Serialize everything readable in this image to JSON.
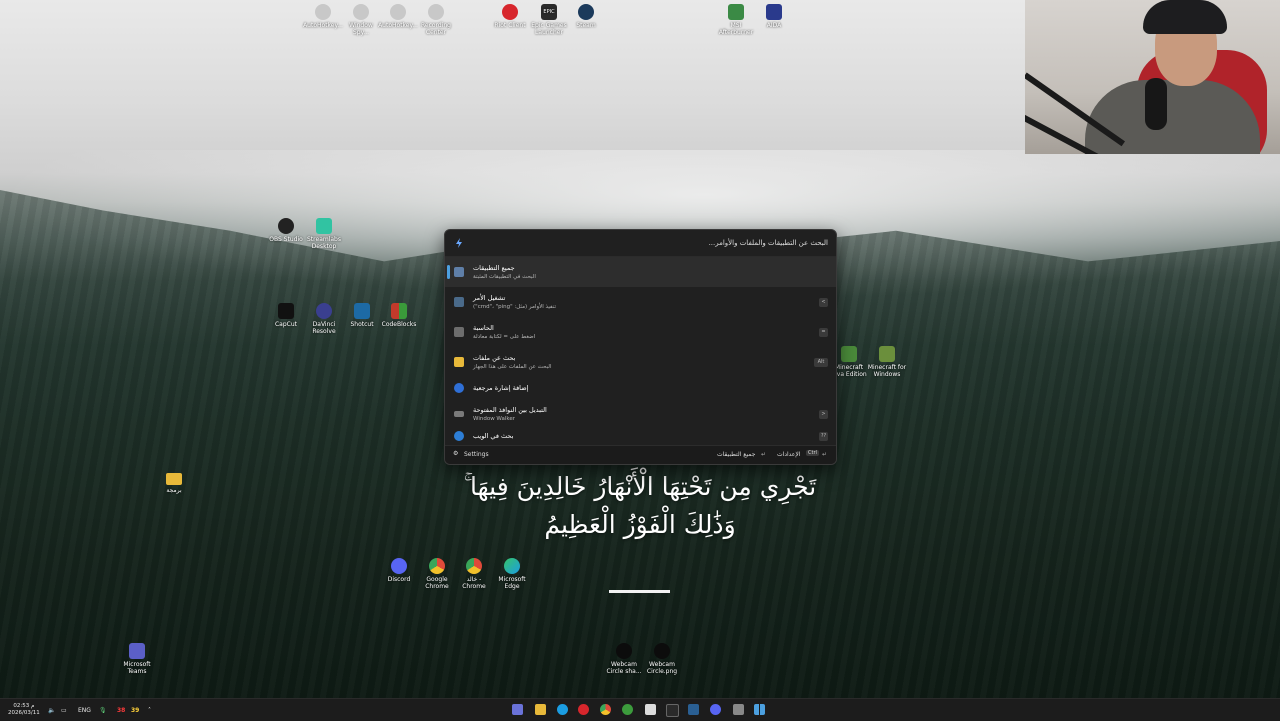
{
  "desktop": {
    "top_icons": [
      {
        "label": "AutoHotkey...",
        "color": "#c8c8c8"
      },
      {
        "label": "Window Spy...",
        "color": "#c8c8c8"
      },
      {
        "label": "AutoHotkey...",
        "color": "#c8c8c8"
      },
      {
        "label": "Recording Center",
        "color": "#c8c8c8"
      },
      {
        "label": "Riot Client",
        "color": "#d7262c"
      },
      {
        "label": "Epic Games Launcher",
        "color": "#2a2a2a"
      },
      {
        "label": "Steam",
        "color": "#1b3a5b"
      },
      {
        "label": "MSI Afterburner",
        "color": "#3b8a45"
      },
      {
        "label": "AIDA",
        "color": "#2a3a8c"
      }
    ],
    "icons": [
      {
        "label": "OBS Studio",
        "color": "#222222"
      },
      {
        "label": "Streamlabs Desktop",
        "color": "#31c3a2"
      },
      {
        "label": "CapCut",
        "color": "#111111"
      },
      {
        "label": "DaVinci Resolve",
        "color": "#3a3f8f"
      },
      {
        "label": "Shotcut",
        "color": "#1d6aa5"
      },
      {
        "label": "CodeBlocks",
        "color": "#c23a2b"
      },
      {
        "label": "Minecraft Java Edition",
        "color": "#4a8a3a"
      },
      {
        "label": "Minecraft for Windows",
        "color": "#6b8f3c"
      },
      {
        "label": "برمجة",
        "color": "#e8b93a"
      },
      {
        "label": "Discord",
        "color": "#5865f2"
      },
      {
        "label": "Google Chrome",
        "color": "#e04a3a"
      },
      {
        "label": "خالد - Chrome",
        "color": "#e04a3a"
      },
      {
        "label": "Microsoft Edge",
        "color": "#1b9de2"
      },
      {
        "label": "Microsoft Teams",
        "color": "#5b5fc7"
      },
      {
        "label": "Webcam Circle sha...",
        "color": "#0c0c0c"
      },
      {
        "label": "Webcam Circle.png",
        "color": "#0c0c0c"
      }
    ],
    "verse_line1": "تَجْرِي مِن تَحْتِهَا الْأَنْهَارُ خَالِدِينَ فِيهَا ۚ",
    "verse_line2": "وَذَٰلِكَ الْفَوْزُ الْعَظِيمُ"
  },
  "launcher": {
    "placeholder": "البحث عن التطبيقات والملفات والأوامر...",
    "accent": "#4ca0e0",
    "results": [
      {
        "title": "جميع التطبيقات",
        "subtitle": "البحث في التطبيقات المثبتة",
        "icon": "grid-icon",
        "color": "#5f7fa8",
        "hint": ""
      },
      {
        "title": "تشغيل الأمر",
        "subtitle": "تنفيذ الأوامر (مثل: \"cmd\"، \"ping\")",
        "icon": "terminal-icon",
        "color": "#4a6a8a",
        "hint": ">"
      },
      {
        "title": "الحاسبة",
        "subtitle": "اضغط على = لكتابة معادلة",
        "icon": "calculator-icon",
        "color": "#6d6d6d",
        "hint": "="
      },
      {
        "title": "بحث عن ملفات",
        "subtitle": "البحث عن الملفات على هذا الجهاز",
        "icon": "folder-icon",
        "color": "#e8b93a",
        "hint": "Alt"
      },
      {
        "title": "إضافة إشارة مرجعية",
        "subtitle": "",
        "icon": "bookmark-icon",
        "color": "#2f6fd6",
        "hint": ""
      },
      {
        "title": "التبديل بين النوافذ المفتوحة",
        "subtitle": "Window Walker",
        "icon": "window-icon",
        "color": "#7a7a7a",
        "hint": "<"
      },
      {
        "title": "بحث في الويب",
        "subtitle": "",
        "icon": "globe-icon",
        "color": "#2d7ed6",
        "hint": "??"
      }
    ],
    "footer": {
      "settings": "Settings",
      "all_apps": "جميع التطبيقات",
      "settings_ar": "الإعدادات",
      "ctrl": "Ctrl"
    }
  },
  "taskbar": {
    "time": "02:53 م",
    "date": "2026/03/11",
    "lang": "ENG",
    "temp1": "38",
    "temp2": "39",
    "apps": [
      {
        "name": "launcher-app",
        "color": "#6a72d8"
      },
      {
        "name": "file-explorer",
        "color": "#e8b93a"
      },
      {
        "name": "edge",
        "color": "#1b9de2"
      },
      {
        "name": "opera",
        "color": "#d7262c"
      },
      {
        "name": "chrome",
        "color": "#e04a3a"
      },
      {
        "name": "xbox",
        "color": "#3c9b3c"
      },
      {
        "name": "calendar",
        "color": "#dcdcdc"
      },
      {
        "name": "epic",
        "color": "#2a2a2a"
      },
      {
        "name": "steam",
        "color": "#2a5f93"
      },
      {
        "name": "discord",
        "color": "#5865f2"
      },
      {
        "name": "terminal",
        "color": "#888888"
      },
      {
        "name": "start",
        "color": "#4ca0e0"
      }
    ]
  }
}
